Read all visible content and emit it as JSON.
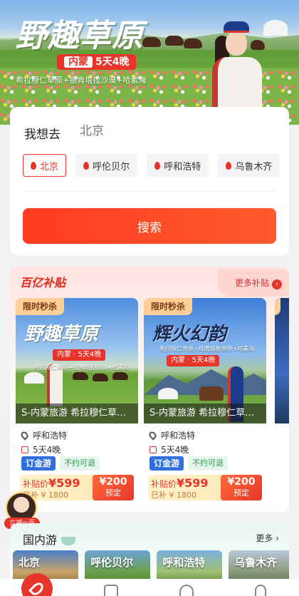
{
  "hero": {
    "title": "野趣草原",
    "badge_dest": "内蒙",
    "badge_text": "5天4晚",
    "subtitle": "希拉穆仁草原+银肯塔拉沙漠+哈素海"
  },
  "search": {
    "label": "我想去",
    "placeholder": "北京",
    "chips": [
      "北京",
      "呼伦贝尔",
      "呼和浩特",
      "乌鲁木齐"
    ],
    "button_label": "搜索"
  },
  "subsidy": {
    "title": "百亿补贴",
    "more_label": "更多补贴",
    "more_arrow": "›",
    "cards": [
      {
        "flash_tag": "限时秒杀",
        "img_title": "野趣草原",
        "img_badge": "内蒙 · 5天4晚",
        "img_sub": "希拉穆仁草原+银肯塔拉沙漠+哈素海",
        "caption": "S-内蒙旅游 希拉穆仁草…",
        "location": "呼和浩特",
        "duration": "5天4晚",
        "tag1": "订金游",
        "tag2": "不约可退",
        "price_label": "补贴价",
        "price": "¥599",
        "original": "已补 ¥ 1800",
        "deposit": "¥200",
        "deposit_label": "预定"
      },
      {
        "flash_tag": "限时秒杀",
        "img_title": "辉火幻韵",
        "img_badge": "内蒙 · 5天4晚",
        "img_sub": "希拉穆仁草原+辉腾锡勒草原+哈素海",
        "caption": "S-内蒙旅游 希拉穆仁草…",
        "location": "呼和浩特",
        "duration": "5天4晚",
        "tag1": "订金游",
        "tag2": "不约可退",
        "price_label": "补贴价",
        "price": "¥599",
        "original": "已补 ¥ 1800",
        "deposit": "¥200",
        "deposit_label": "预定"
      }
    ]
  },
  "float_avatar": {
    "label": "立减一百"
  },
  "domestic": {
    "title": "国内游",
    "more_label": "更多 ›",
    "tiles": [
      "北京",
      "呼伦贝尔",
      "呼和浩特",
      "乌鲁木齐"
    ]
  },
  "colors": {
    "accent": "#e8352b",
    "blue_tag": "#2f6fe0",
    "green_tag": "#2a9a54"
  }
}
